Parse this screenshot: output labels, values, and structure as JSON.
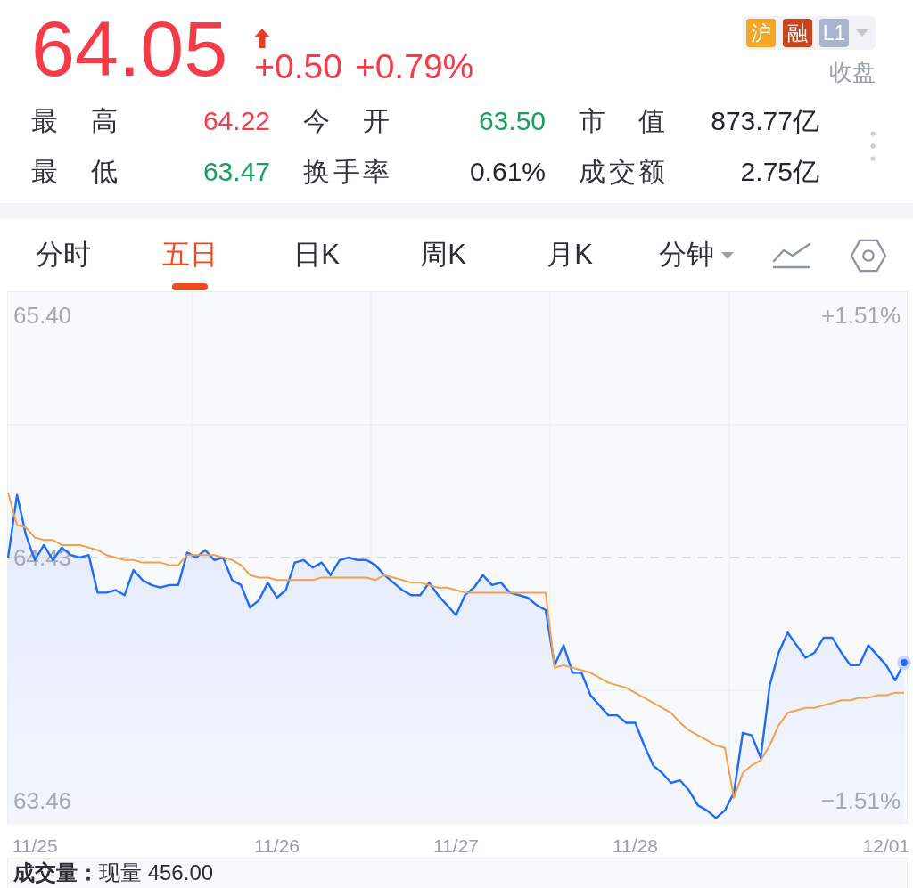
{
  "quote": {
    "price": "64.05",
    "rising": true,
    "change": "+0.50",
    "change_pct": "+0.79%"
  },
  "tags": [
    {
      "label": "沪",
      "color": "#f5a623"
    },
    {
      "label": "融",
      "color": "#c8441d"
    },
    {
      "label": "L1",
      "color": "#aab4cf"
    }
  ],
  "market_status": "收盘",
  "stats": [
    {
      "label": "最高",
      "value": "64.22",
      "color": "#f43b47"
    },
    {
      "label": "今开",
      "value": "63.50",
      "color": "#17a05d"
    },
    {
      "label": "市值",
      "value": "873.77亿",
      "color": "#23262d"
    },
    {
      "label": "最低",
      "value": "63.47",
      "color": "#17a05d"
    },
    {
      "label": "换手率",
      "value": "0.61%",
      "color": "#23262d"
    },
    {
      "label": "成交额",
      "value": "2.75亿",
      "color": "#23262d"
    }
  ],
  "tabs": [
    {
      "label": "分时",
      "selected": false,
      "kind": "tab"
    },
    {
      "label": "五日",
      "selected": true,
      "kind": "tab"
    },
    {
      "label": "日K",
      "selected": false,
      "kind": "tab"
    },
    {
      "label": "周K",
      "selected": false,
      "kind": "tab"
    },
    {
      "label": "月K",
      "selected": false,
      "kind": "tab"
    },
    {
      "label": "分钟",
      "selected": false,
      "kind": "dropdown"
    }
  ],
  "chart": {
    "chart_data": {
      "type": "line",
      "categories": [
        null,
        null,
        null,
        "11/25",
        null,
        null,
        null,
        null,
        null,
        null,
        null,
        null,
        null,
        null,
        null,
        null,
        null,
        null,
        null,
        null,
        null,
        null,
        null,
        null,
        null,
        null,
        null,
        null,
        null,
        null,
        "11/26",
        null,
        null,
        null,
        null,
        null,
        null,
        null,
        null,
        null,
        null,
        null,
        null,
        null,
        null,
        null,
        null,
        null,
        null,
        null,
        "11/27",
        null,
        null,
        null,
        null,
        null,
        null,
        null,
        null,
        null,
        null,
        null,
        null,
        null,
        null,
        null,
        null,
        null,
        null,
        null,
        "11/28",
        null,
        null,
        null,
        null,
        null,
        null,
        null,
        null,
        null,
        null,
        null,
        null,
        null,
        null,
        null,
        null,
        null,
        null,
        null,
        null,
        null,
        null,
        null,
        null,
        null,
        null,
        null,
        "12/01",
        null,
        null
      ],
      "ylim": [
        63.37,
        65.49
      ],
      "yticks": [
        {
          "value": 63.46,
          "label": "63.46"
        },
        {
          "value": 64.43,
          "label": "64.43"
        },
        {
          "value": 65.4,
          "label": "65.40"
        }
      ],
      "y2lim": [
        -1.65,
        1.65
      ],
      "y2ticks": [
        {
          "value": 1.51,
          "label": "+1.51%"
        },
        {
          "value": -1.51,
          "label": "−1.51%"
        }
      ],
      "ref_lines": [
        {
          "axis": "y",
          "value": 64.43
        }
      ],
      "series": [
        {
          "type": "area",
          "color": "#1f6bfa",
          "values": [
            64.43,
            64.68,
            64.52,
            64.42,
            64.48,
            64.42,
            64.47,
            64.44,
            64.43,
            64.44,
            64.29,
            64.29,
            64.3,
            64.28,
            64.38,
            64.34,
            64.32,
            64.31,
            64.32,
            64.32,
            64.45,
            64.43,
            64.46,
            64.42,
            64.43,
            64.34,
            64.32,
            64.23,
            64.26,
            64.33,
            64.27,
            64.3,
            64.41,
            64.42,
            64.39,
            64.41,
            64.36,
            64.42,
            64.43,
            64.42,
            64.42,
            64.4,
            64.36,
            64.33,
            64.3,
            64.28,
            64.28,
            64.33,
            64.28,
            64.24,
            64.2,
            64.28,
            64.31,
            64.36,
            64.32,
            64.33,
            64.29,
            64.28,
            64.27,
            64.24,
            64.22,
            64.0,
            64.08,
            63.97,
            63.97,
            63.88,
            63.84,
            63.8,
            63.8,
            63.77,
            63.77,
            63.68,
            63.6,
            63.57,
            63.53,
            63.54,
            63.5,
            63.44,
            63.42,
            63.39,
            63.42,
            63.49,
            63.73,
            63.72,
            63.63,
            63.92,
            64.05,
            64.13,
            64.08,
            64.03,
            64.05,
            64.11,
            64.11,
            64.05,
            64.0,
            64.0,
            64.08,
            64.04,
            64.0,
            63.94,
            64.01
          ]
        },
        {
          "type": "line",
          "color": "#f5a04a",
          "values": [
            64.69,
            64.56,
            64.55,
            64.51,
            64.5,
            64.5,
            64.48,
            64.48,
            64.48,
            64.47,
            64.46,
            64.44,
            64.43,
            64.42,
            64.42,
            64.41,
            64.41,
            64.41,
            64.4,
            64.4,
            64.44,
            64.44,
            64.44,
            64.44,
            64.43,
            64.42,
            64.4,
            64.36,
            64.35,
            64.35,
            64.34,
            64.34,
            64.34,
            64.34,
            64.34,
            64.35,
            64.35,
            64.35,
            64.35,
            64.35,
            64.35,
            64.34,
            64.36,
            64.35,
            64.34,
            64.33,
            64.33,
            64.32,
            64.31,
            64.31,
            64.3,
            64.29,
            64.29,
            64.29,
            64.29,
            64.29,
            64.29,
            64.29,
            64.29,
            64.29,
            64.29,
            63.99,
            64.0,
            63.99,
            63.98,
            63.97,
            63.95,
            63.93,
            63.92,
            63.91,
            63.89,
            63.87,
            63.85,
            63.83,
            63.81,
            63.77,
            63.74,
            63.72,
            63.7,
            63.68,
            63.67,
            63.47,
            63.57,
            63.6,
            63.62,
            63.68,
            63.76,
            63.81,
            63.82,
            63.83,
            63.83,
            63.84,
            63.85,
            63.86,
            63.86,
            63.87,
            63.87,
            63.88,
            63.88,
            63.89,
            63.89
          ]
        }
      ]
    }
  },
  "volume": {
    "summary": "**成交量：**现量 456.00"
  }
}
